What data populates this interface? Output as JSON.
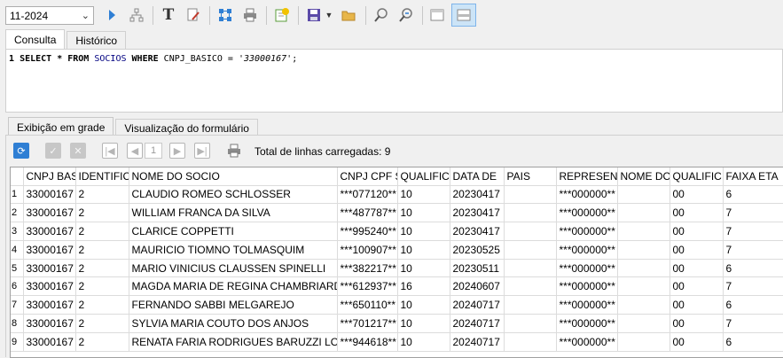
{
  "toolbar": {
    "database": "11-2024",
    "icons": [
      "run-icon",
      "explain-icon",
      "format-icon",
      "clear-icon",
      "schema-icon",
      "print-icon",
      "add-query-icon",
      "save-icon",
      "dropdown-icon",
      "open-icon",
      "find-icon",
      "replace-icon",
      "layout-single-icon",
      "layout-split-icon"
    ]
  },
  "editor_tabs": [
    "Consulta",
    "Histórico"
  ],
  "editor": {
    "line_number": "1",
    "sql": {
      "select": "SELECT",
      "star": " * ",
      "from": "FROM",
      "table": "SOCIOS",
      "where": "WHERE",
      "column": "CNPJ_BASICO",
      "eq": " = ",
      "value": "'33000167'",
      "end": ";"
    }
  },
  "result_tabs": [
    "Exibição em grade",
    "Visualização do formulário"
  ],
  "navigation": {
    "page": "1",
    "total_label": "Total de linhas carregadas: 9"
  },
  "table": {
    "columns": [
      "CNPJ BAS",
      "IDENTIFIC",
      "NOME DO SOCIO",
      "CNPJ CPF S",
      "QUALIFIC",
      "DATA DE",
      "PAIS",
      "REPRESENT",
      "NOME DO",
      "QUALIFIC",
      "FAIXA ETA"
    ],
    "rows": [
      [
        "1",
        "33000167",
        "2",
        "CLAUDIO ROMEO SCHLOSSER",
        "***077120**",
        "10",
        "20230417",
        "",
        "***000000**",
        "",
        "00",
        "6"
      ],
      [
        "2",
        "33000167",
        "2",
        "WILLIAM FRANCA DA SILVA",
        "***487787**",
        "10",
        "20230417",
        "",
        "***000000**",
        "",
        "00",
        "7"
      ],
      [
        "3",
        "33000167",
        "2",
        "CLARICE COPPETTI",
        "***995240**",
        "10",
        "20230417",
        "",
        "***000000**",
        "",
        "00",
        "7"
      ],
      [
        "4",
        "33000167",
        "2",
        "MAURICIO TIOMNO TOLMASQUIM",
        "***100907**",
        "10",
        "20230525",
        "",
        "***000000**",
        "",
        "00",
        "7"
      ],
      [
        "5",
        "33000167",
        "2",
        "MARIO VINICIUS CLAUSSEN SPINELLI",
        "***382217**",
        "10",
        "20230511",
        "",
        "***000000**",
        "",
        "00",
        "6"
      ],
      [
        "6",
        "33000167",
        "2",
        "MAGDA MARIA DE REGINA CHAMBRIARD",
        "***612937**",
        "16",
        "20240607",
        "",
        "***000000**",
        "",
        "00",
        "7"
      ],
      [
        "7",
        "33000167",
        "2",
        "FERNANDO SABBI MELGAREJO",
        "***650110**",
        "10",
        "20240717",
        "",
        "***000000**",
        "",
        "00",
        "6"
      ],
      [
        "8",
        "33000167",
        "2",
        "SYLVIA MARIA COUTO DOS ANJOS",
        "***701217**",
        "10",
        "20240717",
        "",
        "***000000**",
        "",
        "00",
        "7"
      ],
      [
        "9",
        "33000167",
        "2",
        "RENATA FARIA RODRIGUES BARUZZI LOPES",
        "***944618**",
        "10",
        "20240717",
        "",
        "***000000**",
        "",
        "00",
        "6"
      ]
    ]
  }
}
